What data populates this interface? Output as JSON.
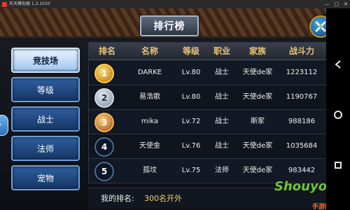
{
  "window": {
    "title": "天天模拟器 1.2.1010",
    "controls": [
      "—",
      "□",
      "✕"
    ]
  },
  "page": {
    "title": "排行榜"
  },
  "tabs": [
    {
      "label": "竞技场",
      "active": true
    },
    {
      "label": "等级",
      "active": false
    },
    {
      "label": "战士",
      "active": false
    },
    {
      "label": "法师",
      "active": false
    },
    {
      "label": "宠物",
      "active": false
    }
  ],
  "table": {
    "headers": [
      "排名",
      "名称",
      "等级",
      "职业",
      "家族",
      "战斗力"
    ],
    "rows": [
      {
        "rank": "1",
        "medal": "gold",
        "name": "DARKE",
        "level": "Lv.80",
        "job": "战士",
        "family": "天使de家",
        "power": "1223112"
      },
      {
        "rank": "2",
        "medal": "silver",
        "name": "易浩歌",
        "level": "Lv.80",
        "job": "战士",
        "family": "天使de家",
        "power": "1190767"
      },
      {
        "rank": "3",
        "medal": "bronze",
        "name": "mika",
        "level": "Lv.72",
        "job": "战士",
        "family": "斯家",
        "power": "988186"
      },
      {
        "rank": "4",
        "medal": "plain",
        "name": "天使金",
        "level": "Lv.76",
        "job": "战士",
        "family": "天使de家",
        "power": "1035684"
      },
      {
        "rank": "5",
        "medal": "plain",
        "name": "孤坟",
        "level": "Lv.75",
        "job": "法师",
        "family": "天使de家",
        "power": "983442"
      }
    ]
  },
  "footer": {
    "my_rank_label": "我的排名:",
    "my_rank_value": "300名开外"
  },
  "watermark": {
    "main": "Shouyou",
    "sub": "手游网"
  },
  "icons": {
    "close": "close-crossed-swords-icon",
    "handle": "drawer-handle-icon",
    "nav": [
      "back-icon",
      "home-icon",
      "recent-apps-icon"
    ]
  },
  "colors": {
    "accent": "#e9c57a",
    "tab_active_bg": "#eaf4ff",
    "tab_bg": "#2f5fa0",
    "my_rank": "#f0d36a"
  }
}
